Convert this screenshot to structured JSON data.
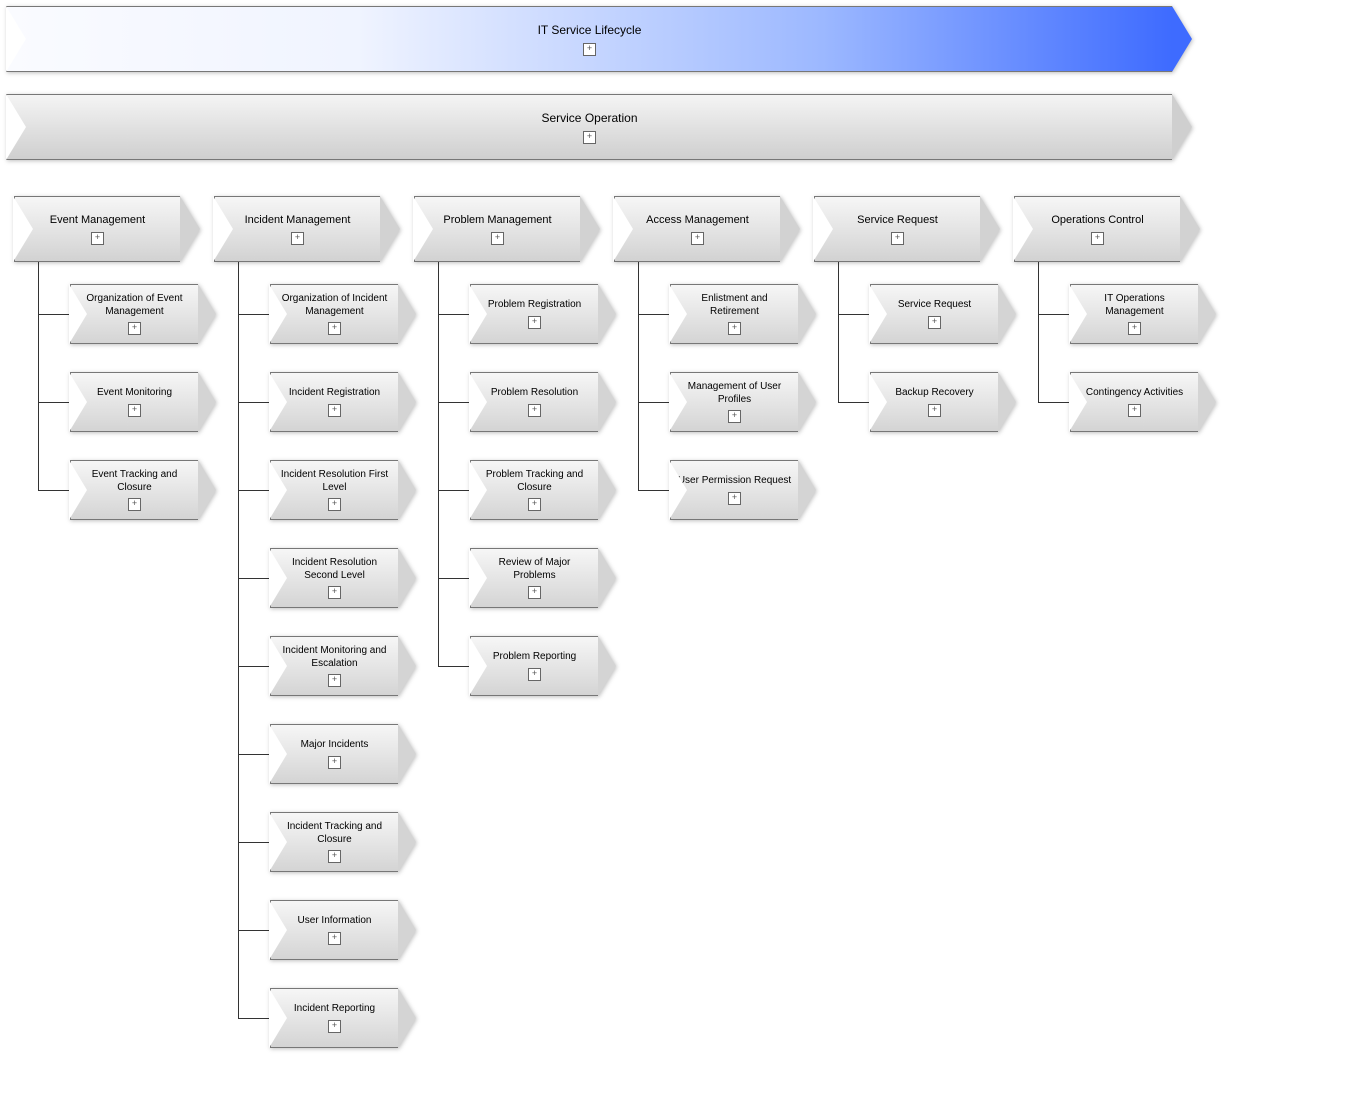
{
  "top1": "IT Service Lifecycle",
  "top2": "Service Operation",
  "columns": [
    {
      "title": "Event Management",
      "children": [
        {
          "label": "Organization of Event Management",
          "plus": true
        },
        {
          "label": "Event Monitoring",
          "plus": true
        },
        {
          "label": "Event Tracking and Closure",
          "plus": true
        }
      ]
    },
    {
      "title": "Incident Management",
      "children": [
        {
          "label": "Organization of Incident Management",
          "plus": true
        },
        {
          "label": "Incident Registration",
          "plus": true
        },
        {
          "label": "Incident Resolution First Level",
          "plus": true
        },
        {
          "label": "Incident Resolution Second Level",
          "plus": true
        },
        {
          "label": "Incident Monitoring and Escalation",
          "plus": true
        },
        {
          "label": "Major Incidents",
          "plus": true
        },
        {
          "label": "Incident Tracking and Closure",
          "plus": true
        },
        {
          "label": "User Information",
          "plus": true
        },
        {
          "label": "Incident Reporting",
          "plus": true
        }
      ]
    },
    {
      "title": "Problem Management",
      "children": [
        {
          "label": "Problem Registration",
          "plus": true
        },
        {
          "label": "Problem Resolution",
          "plus": true
        },
        {
          "label": "Problem Tracking and Closure",
          "plus": true
        },
        {
          "label": "Review of Major Problems",
          "plus": true
        },
        {
          "label": "Problem Reporting",
          "plus": true
        }
      ]
    },
    {
      "title": "Access Management",
      "children": [
        {
          "label": "Enlistment and Retirement",
          "plus": true
        },
        {
          "label": "Management of User Profiles",
          "plus": true
        },
        {
          "label": "User Permission Request",
          "plus": true
        }
      ]
    },
    {
      "title": "Service Request",
      "children": [
        {
          "label": "Service Request",
          "plus": true
        },
        {
          "label": "Backup Recovery",
          "plus": true
        }
      ]
    },
    {
      "title": "Operations Control",
      "children": [
        {
          "label": "IT Operations Management",
          "plus": true
        },
        {
          "label": "Contingency Activities",
          "plus": true
        }
      ]
    }
  ]
}
